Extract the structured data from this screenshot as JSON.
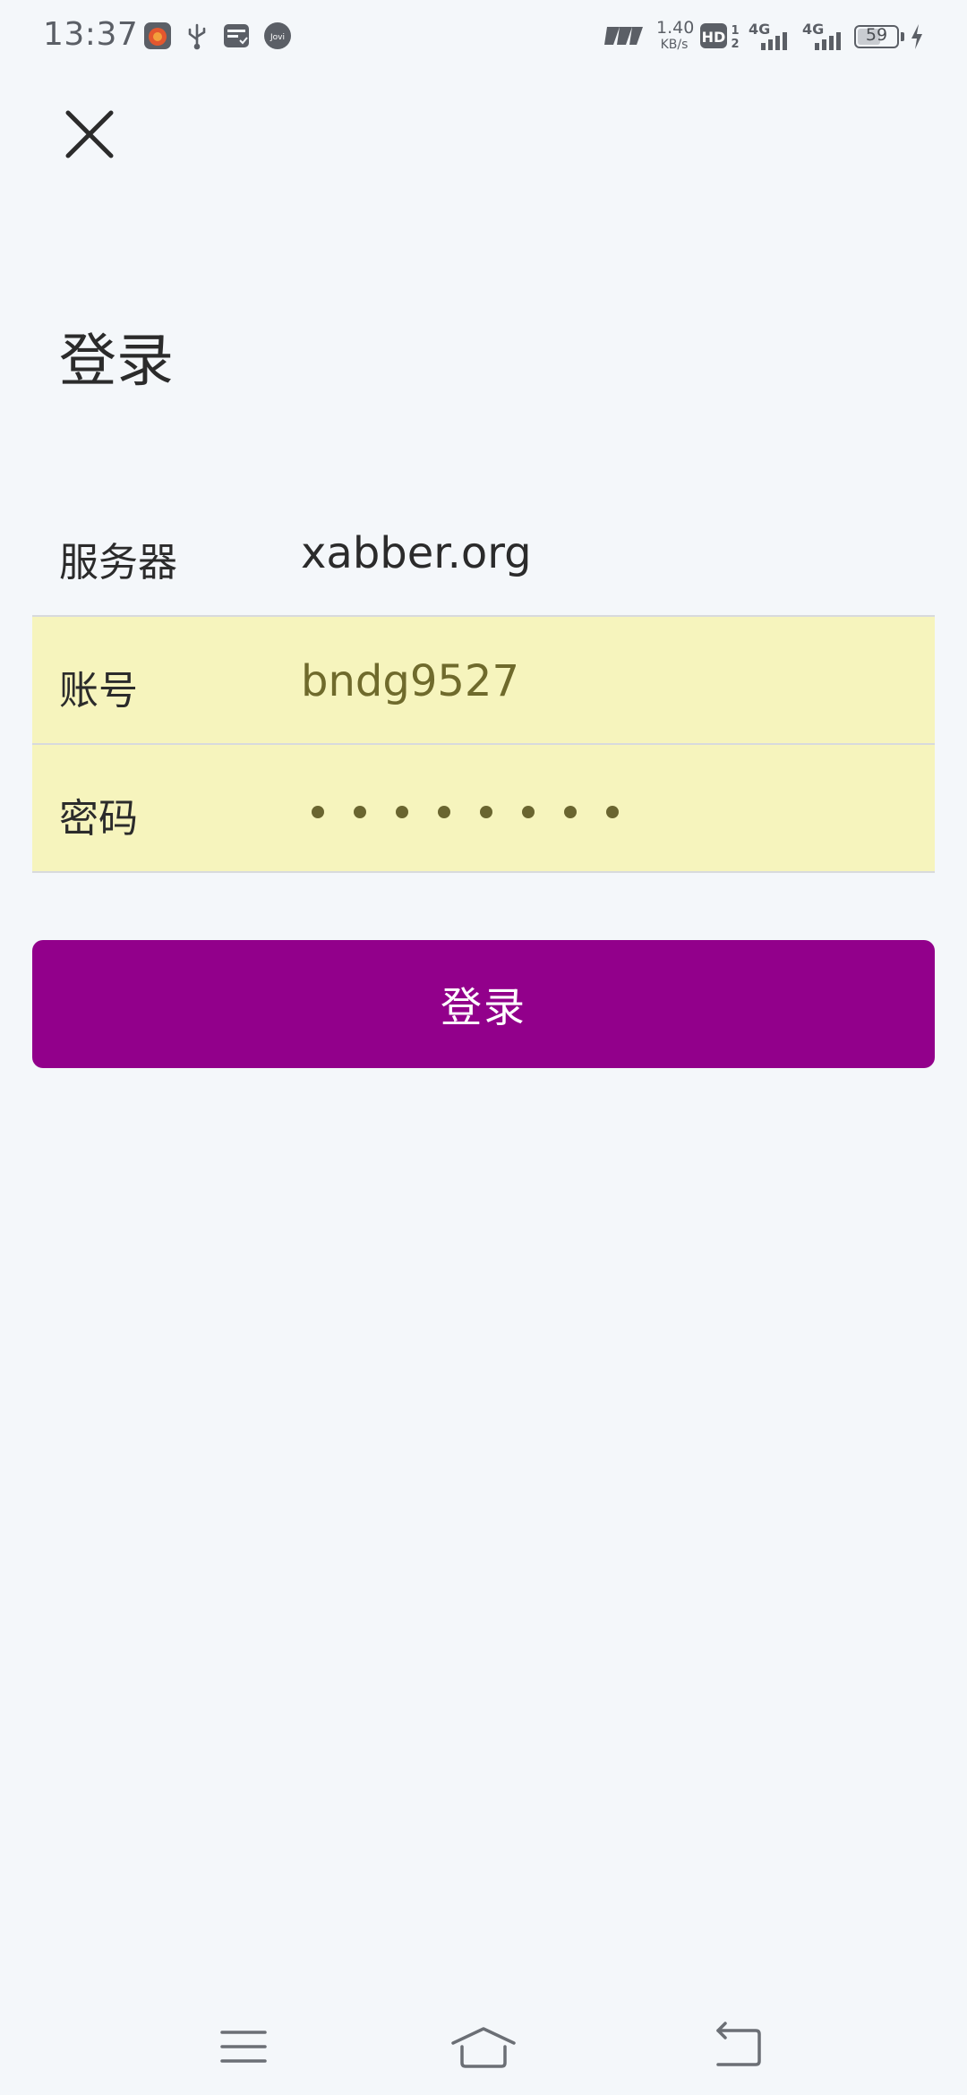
{
  "status_bar": {
    "time": "13:37",
    "net_speed_value": "1.40",
    "net_speed_unit": "KB/s",
    "signal_1": "4G",
    "signal_2": "4G",
    "battery": "59",
    "battery_level": 0.59,
    "icons": [
      "app-notification-icon",
      "usb-icon",
      "sim-card-icon",
      "jovi-icon",
      "volte-icon",
      "hd-icon",
      "signal-icon",
      "battery-icon",
      "charging-icon"
    ]
  },
  "header": {
    "close_icon": "close-icon"
  },
  "page": {
    "title": "登录"
  },
  "form": {
    "server_label": "服务器",
    "server_value": "xabber.org",
    "account_label": "账号",
    "account_value": "bndg9527",
    "password_label": "密码",
    "password_length": 8
  },
  "actions": {
    "login_label": "登录"
  },
  "nav_bar": {
    "icons": [
      "menu-icon",
      "home-icon",
      "back-icon"
    ]
  },
  "colors": {
    "background": "#f4f7fa",
    "autofill": "#f6f4bd",
    "primary": "#92008b"
  }
}
